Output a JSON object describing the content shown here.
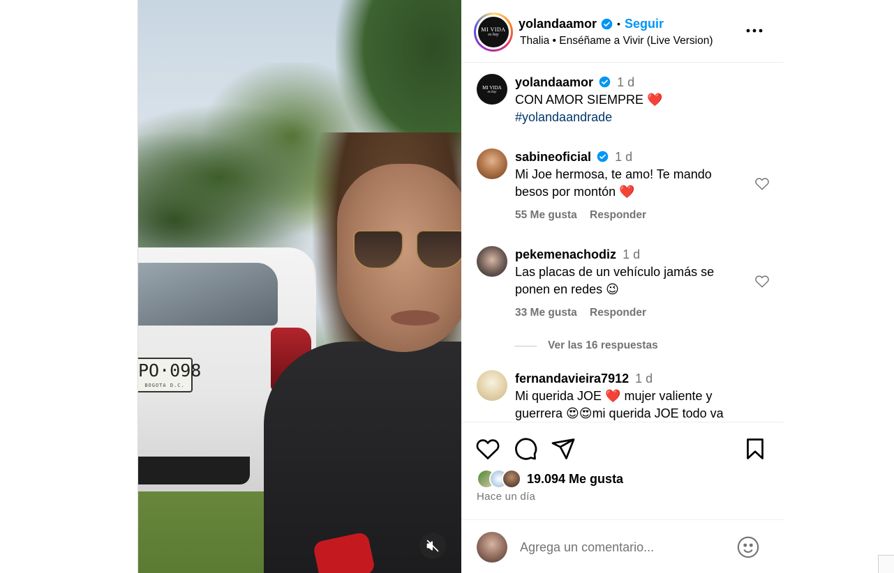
{
  "post": {
    "username": "yolandaamor",
    "follow_label": "Seguir",
    "separator": "•",
    "audio": "Thalia • Enséñame a Vivir (Live Version)",
    "more_icon": "more-horizontal-icon",
    "avatar_text_line1": "MI VIDA",
    "avatar_text_line2": "es hoy"
  },
  "media": {
    "plate_number": "PO·098",
    "plate_city": "BOGOTA D.C.",
    "mute_icon": "speaker-muted-icon"
  },
  "caption": {
    "username": "yolandaamor",
    "time": "1 d",
    "text": "CON AMOR SIEMPRE ❤️",
    "hashtag": "#yolandaandrade"
  },
  "comments": [
    {
      "username": "sabineoficial",
      "verified": true,
      "time": "1 d",
      "text": "Mi Joe hermosa, te amo! Te mando besos por montón ❤️",
      "likes": "55 Me gusta",
      "reply_label": "Responder"
    },
    {
      "username": "pekemenachodiz",
      "verified": false,
      "time": "1 d",
      "text": "Las placas de un vehículo jamás se ponen en redes 😉",
      "likes": "33 Me gusta",
      "reply_label": "Responder",
      "view_replies": "Ver las 16 respuestas"
    },
    {
      "username": "fernandavieira7912",
      "verified": false,
      "time": "1 d",
      "text": "Mi querida JOE ❤️ mujer valiente y guerrera 😍😍mi querida JOE todo va"
    }
  ],
  "actions": {
    "like_icon": "heart-icon",
    "comment_icon": "comment-icon",
    "share_icon": "send-icon",
    "save_icon": "bookmark-icon",
    "likes_count": "19.094 Me gusta",
    "posted_ago": "Hace un día"
  },
  "add_comment": {
    "placeholder": "Agrega un comentario...",
    "emoji_icon": "emoji-icon"
  },
  "colors": {
    "link_blue": "#0095f6",
    "hashtag_blue": "#00376b",
    "muted_gray": "#737373",
    "verified_blue": "#0095f6",
    "heart_red": "#ed4956"
  }
}
